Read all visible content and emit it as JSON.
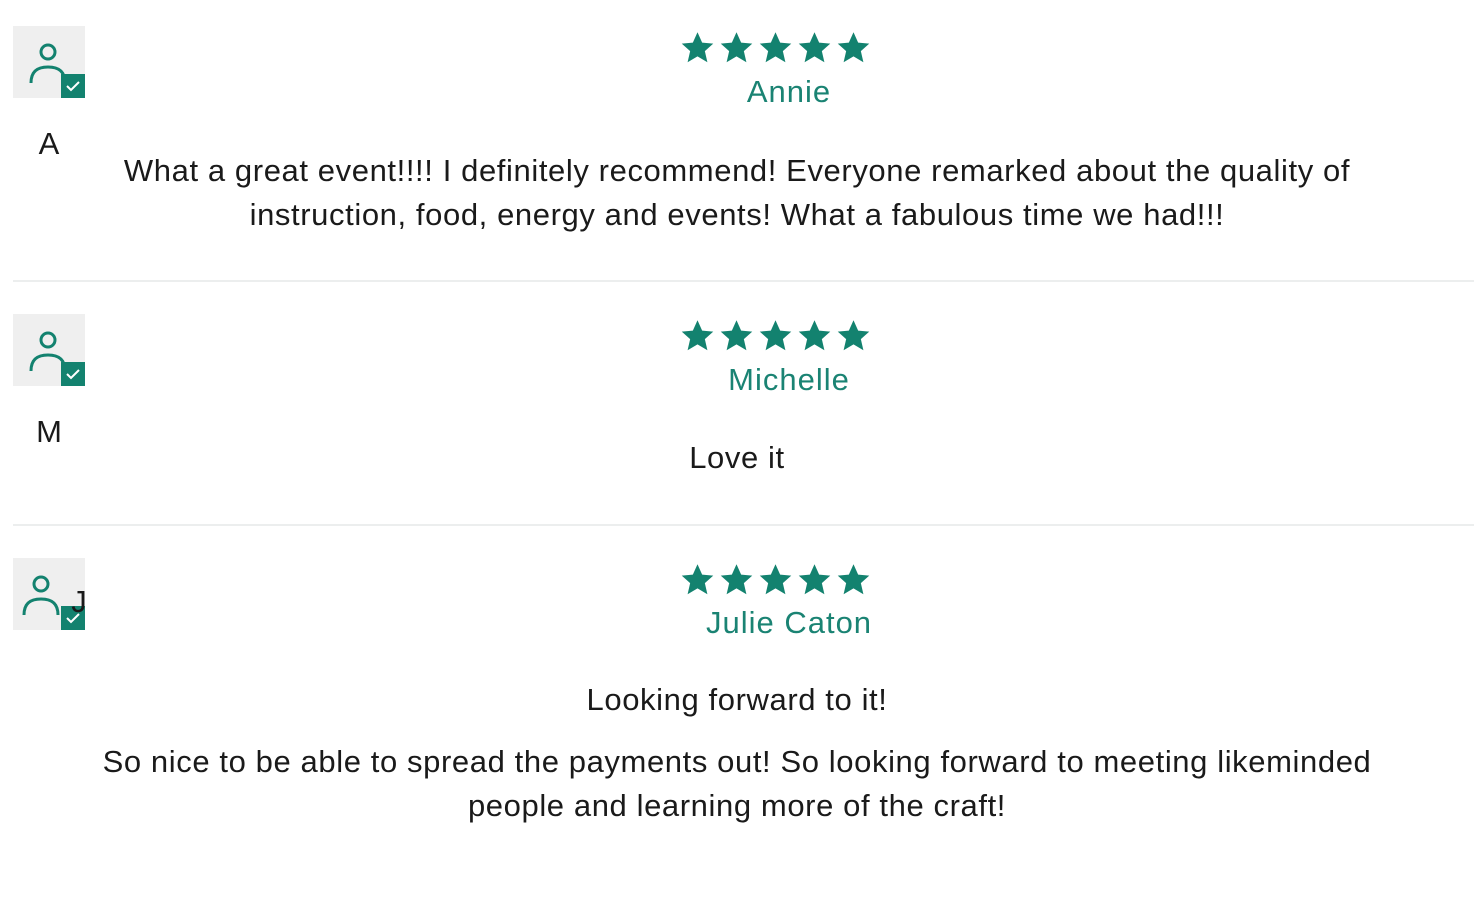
{
  "colors": {
    "accent": "#13826f",
    "reviewer_name": "#1a8373",
    "avatar_background": "#efefef",
    "divider": "#eceeee",
    "text": "#1a1a1a"
  },
  "icons": {
    "avatar": "person-icon",
    "badge": "verified-check-icon",
    "rating": "star-icon"
  },
  "reviews": [
    {
      "initial": "A",
      "rating": 5,
      "rating_max": 5,
      "reviewer": "Annie",
      "title": "",
      "body_lines": [
        "What a great event!!!! I definitely recommend! Everyone remarked about the quality of",
        "instruction, food, energy and events! What a fabulous time we had!!!"
      ]
    },
    {
      "initial": "M",
      "rating": 5,
      "rating_max": 5,
      "reviewer": "Michelle",
      "title": "",
      "body_lines": [
        "Love it"
      ]
    },
    {
      "initial": "J",
      "rating": 5,
      "rating_max": 5,
      "reviewer": "Julie Caton",
      "title": "Looking forward to it!",
      "body_lines": [
        "So nice to be able to spread the payments out! So looking forward to meeting likeminded",
        "people and learning more of the craft!"
      ]
    }
  ]
}
